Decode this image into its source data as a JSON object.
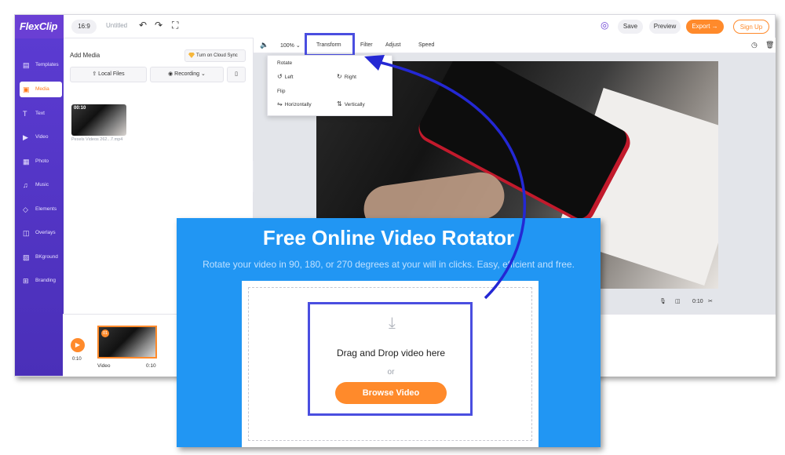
{
  "app": {
    "logo": "FlexClip",
    "ratio": "16:9",
    "doc_title": "Untitled"
  },
  "topbar": {
    "save": "Save",
    "preview": "Preview",
    "export": "Export →",
    "signup": "Sign Up"
  },
  "rail": [
    {
      "label": "Templates",
      "icon": "templates-icon"
    },
    {
      "label": "Media",
      "icon": "media-icon"
    },
    {
      "label": "Text",
      "icon": "text-icon"
    },
    {
      "label": "Video",
      "icon": "video-icon"
    },
    {
      "label": "Photo",
      "icon": "photo-icon"
    },
    {
      "label": "Music",
      "icon": "music-icon"
    },
    {
      "label": "Elements",
      "icon": "elements-icon"
    },
    {
      "label": "Overlays",
      "icon": "overlays-icon"
    },
    {
      "label": "BKground",
      "icon": "background-icon"
    },
    {
      "label": "Branding",
      "icon": "branding-icon"
    }
  ],
  "media": {
    "title": "Add Media",
    "cloud": "Turn on Cloud Sync",
    "local": "Local Files",
    "recording": "Recording",
    "thumb_time": "00:10",
    "thumb_name": "Pexels Videos 262...7.mp4"
  },
  "toolbar": {
    "zoom": "100%",
    "transform": "Transform",
    "filter": "Filter",
    "adjust": "Adjust",
    "speed": "Speed"
  },
  "dropdown": {
    "rotate": "Rotate",
    "left": "Left",
    "right": "Right",
    "flip": "Flip",
    "horizontally": "Horizontally",
    "vertically": "Vertically"
  },
  "player": {
    "time": "0:10"
  },
  "timeline": {
    "time": "0:10",
    "clip_num": "01",
    "clip_label": "Video",
    "clip_dur": "0:10"
  },
  "overlay": {
    "title": "Free Online Video Rotator",
    "subtitle": "Rotate your video in 90, 180, or 270 degrees at your will in clicks. Easy, efficient and free.",
    "drag": "Drag and Drop video here",
    "or": "or",
    "browse": "Browse Video"
  },
  "colors": {
    "accent": "#ff8a2b",
    "rail": "#5b3bd1",
    "overlay": "#2196f3",
    "highlight": "#4a4ee0"
  }
}
